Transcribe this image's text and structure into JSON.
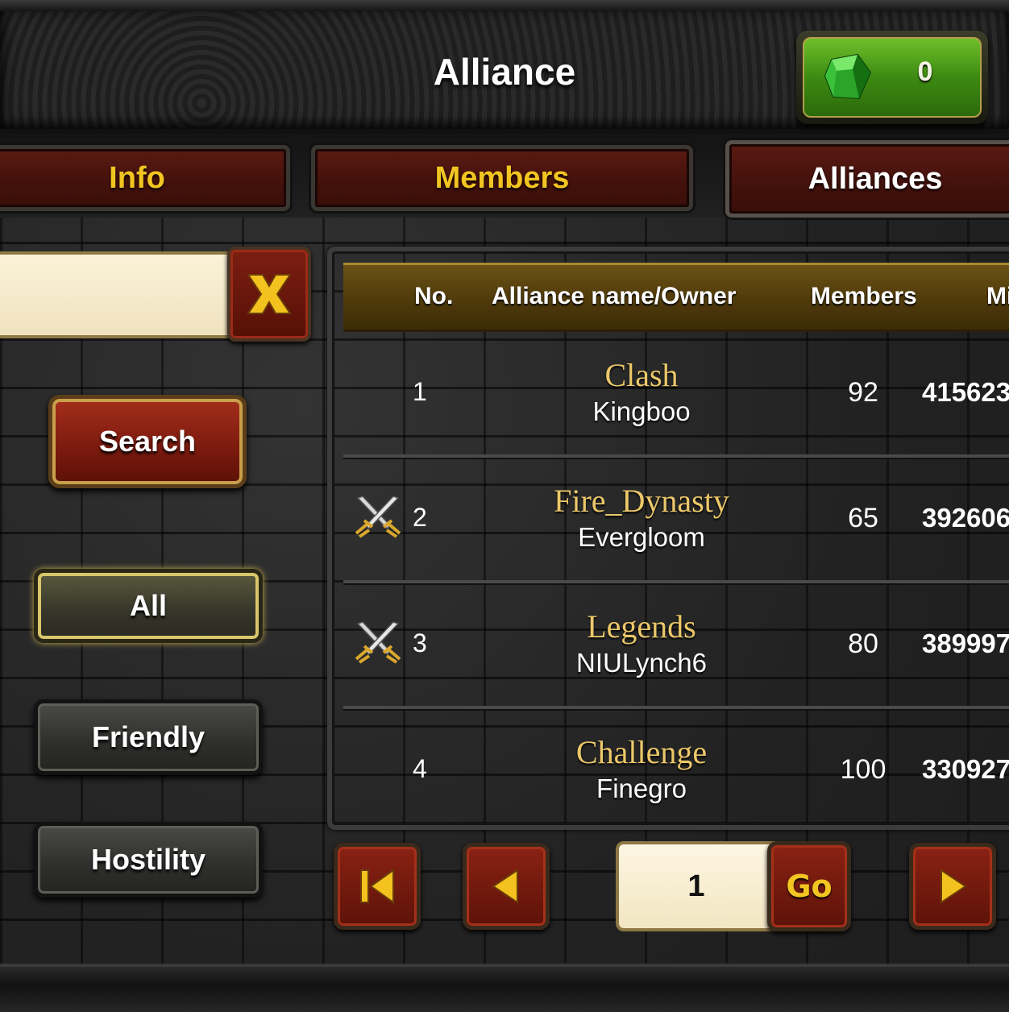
{
  "header": {
    "title": "Alliance",
    "gems": "0",
    "gem_icon": "emerald-gem-icon"
  },
  "tabs": [
    {
      "label": "Info",
      "active": false
    },
    {
      "label": "Members",
      "active": false
    },
    {
      "label": "Alliances",
      "active": true
    }
  ],
  "search": {
    "value": "",
    "clear_icon": "close-x-icon",
    "button_label": "Search"
  },
  "filters": [
    {
      "label": "All",
      "selected": true
    },
    {
      "label": "Friendly",
      "selected": false
    },
    {
      "label": "Hostility",
      "selected": false
    }
  ],
  "table": {
    "headers": {
      "no": "No.",
      "name": "Alliance name/Owner",
      "members": "Members",
      "power": "Mi"
    },
    "rows": [
      {
        "no": "1",
        "name": "Clash",
        "owner": "Kingboo",
        "members": "92",
        "power": "415623",
        "war_icon": false
      },
      {
        "no": "2",
        "name": "Fire_Dynasty",
        "owner": "Evergloom",
        "members": "65",
        "power": "392606",
        "war_icon": true
      },
      {
        "no": "3",
        "name": "Legends",
        "owner": "NIULynch6",
        "members": "80",
        "power": "389997",
        "war_icon": true
      },
      {
        "no": "4",
        "name": "Challenge",
        "owner": "Finegro",
        "members": "100",
        "power": "330927",
        "war_icon": false
      }
    ]
  },
  "pager": {
    "page": "1",
    "go_label": "Go",
    "icons": [
      "first-page-icon",
      "prev-page-icon",
      "next-page-icon"
    ]
  },
  "colors": {
    "tab_text": "#f3c521",
    "alliance_name": "#ecc86a",
    "gem_green": "#4f9f1c",
    "header_gold": "#6b5114"
  }
}
